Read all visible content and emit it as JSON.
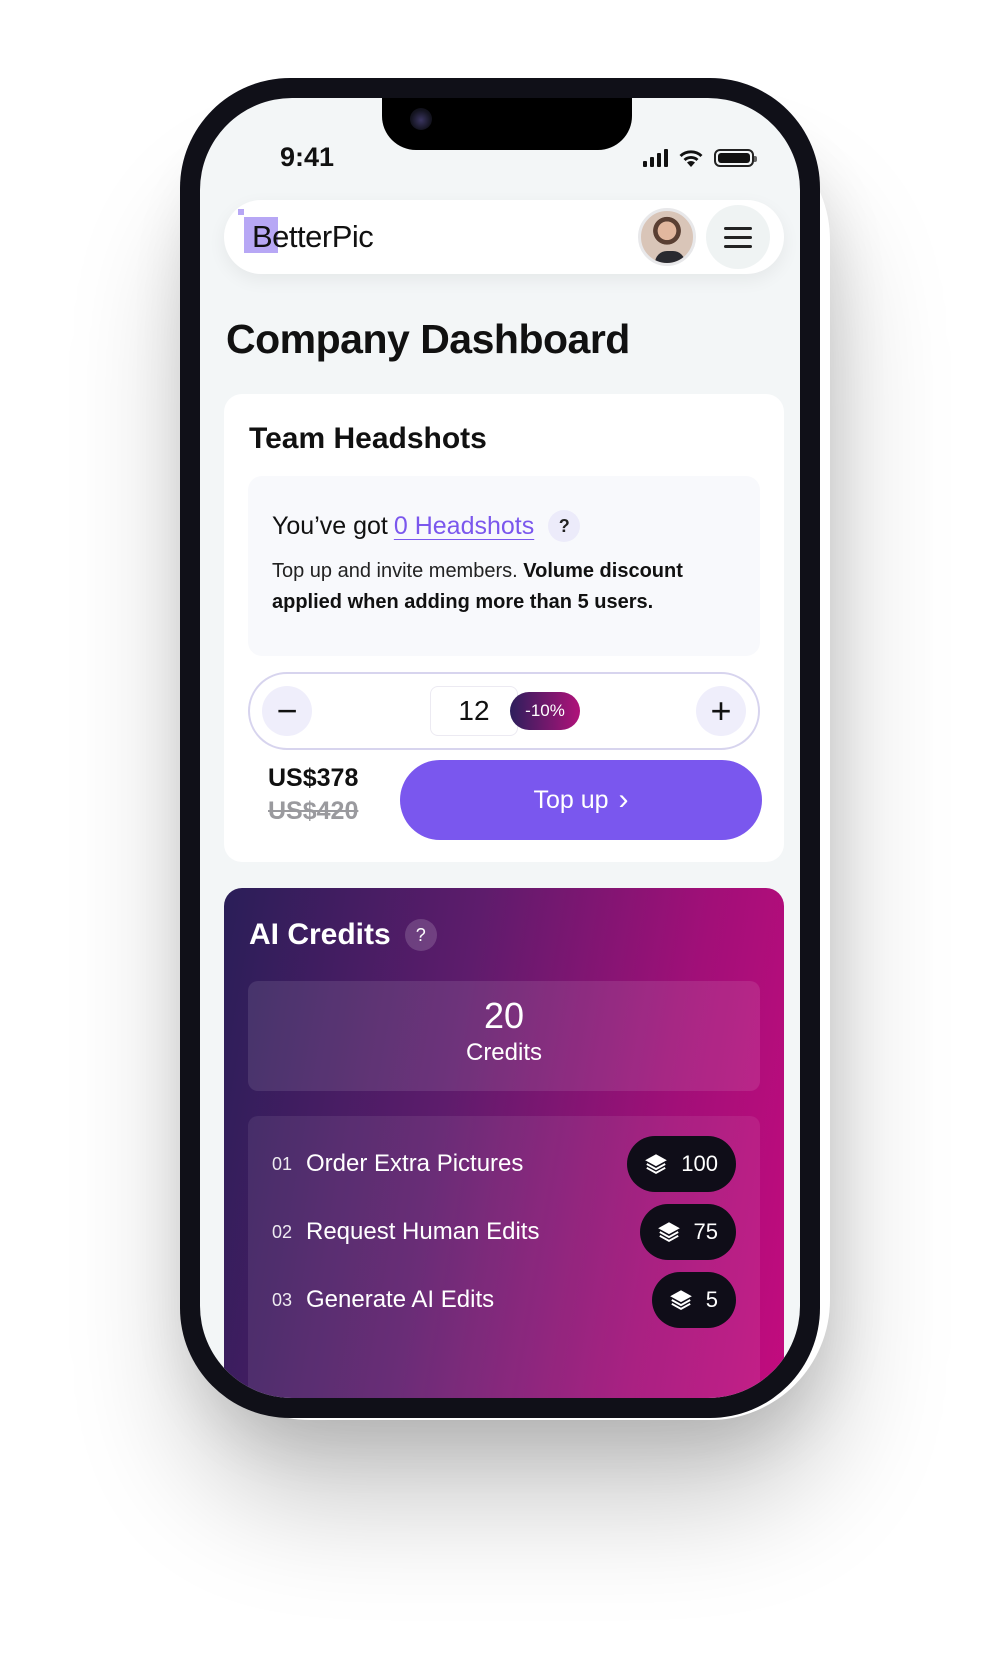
{
  "status_bar": {
    "time": "9:41"
  },
  "header": {
    "logo_text": "BetterPic"
  },
  "page": {
    "title": "Company Dashboard"
  },
  "team_headshots": {
    "title": "Team Headshots",
    "got_prefix": "You’ve got",
    "got_link": "0 Headshots",
    "help": "?",
    "desc_plain": "Top up and invite members. ",
    "desc_bold": "Volume discount applied when adding more than 5 users.",
    "quantity": "12",
    "minus": "−",
    "plus": "+",
    "discount_badge": "-10%",
    "price_now": "US$378",
    "price_old": "US$420",
    "topup_label": "Top up",
    "topup_chevron": "›"
  },
  "ai_credits": {
    "title": "AI Credits",
    "help": "?",
    "credits_count": "20",
    "credits_label": "Credits",
    "items": [
      {
        "num": "01",
        "label": "Order Extra Pictures",
        "cost": "100"
      },
      {
        "num": "02",
        "label": "Request Human Edits",
        "cost": "75"
      },
      {
        "num": "03",
        "label": "Generate AI Edits",
        "cost": "5"
      }
    ]
  },
  "colors": {
    "accent": "#7a57ee",
    "link": "#7b57ed",
    "credits_gradient_start": "#2a1e58",
    "credits_gradient_end": "#c30b7e"
  }
}
